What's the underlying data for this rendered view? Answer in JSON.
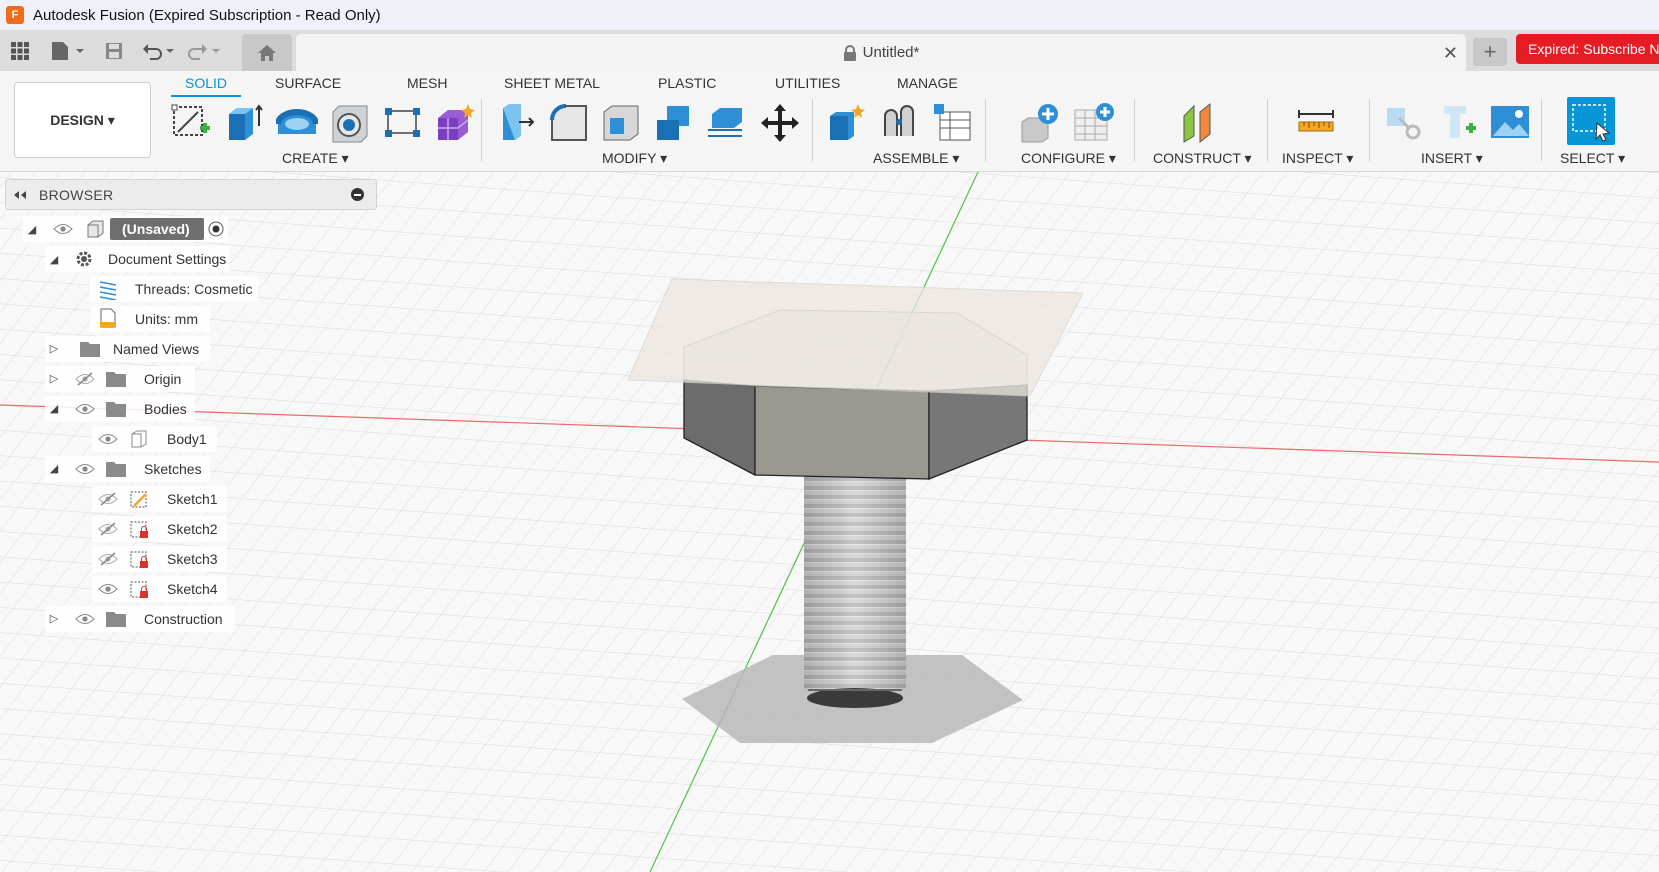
{
  "window": {
    "title": "Autodesk Fusion (Expired Subscription - Read Only)"
  },
  "tabs": {
    "doc_title": "Untitled*",
    "close_glyph": "✕",
    "new_tab_glyph": "+",
    "expired_label": "Expired: Subscribe N"
  },
  "toolbar": {
    "workspace": "DESIGN ▾",
    "ws_tabs": [
      "SOLID",
      "SURFACE",
      "MESH",
      "SHEET METAL",
      "PLASTIC",
      "UTILITIES",
      "MANAGE"
    ],
    "groups": [
      "CREATE ▾",
      "MODIFY ▾",
      "ASSEMBLE ▾",
      "CONFIGURE ▾",
      "CONSTRUCT ▾",
      "INSPECT ▾",
      "INSERT ▾",
      "SELECT ▾"
    ]
  },
  "browser": {
    "title": "BROWSER",
    "root": "(Unsaved)",
    "items": {
      "document_settings": "Document Settings",
      "threads": "Threads: Cosmetic",
      "units": "Units: mm",
      "named_views": "Named Views",
      "origin": "Origin",
      "bodies": "Bodies",
      "body1": "Body1",
      "sketches": "Sketches",
      "sketch1": "Sketch1",
      "sketch2": "Sketch2",
      "sketch3": "Sketch3",
      "sketch4": "Sketch4",
      "construction": "Construction"
    }
  },
  "colors": {
    "accent": "#0696d7",
    "expired": "#e51c23",
    "x_axis": "#e86c6c",
    "y_axis": "#4fc24f"
  }
}
